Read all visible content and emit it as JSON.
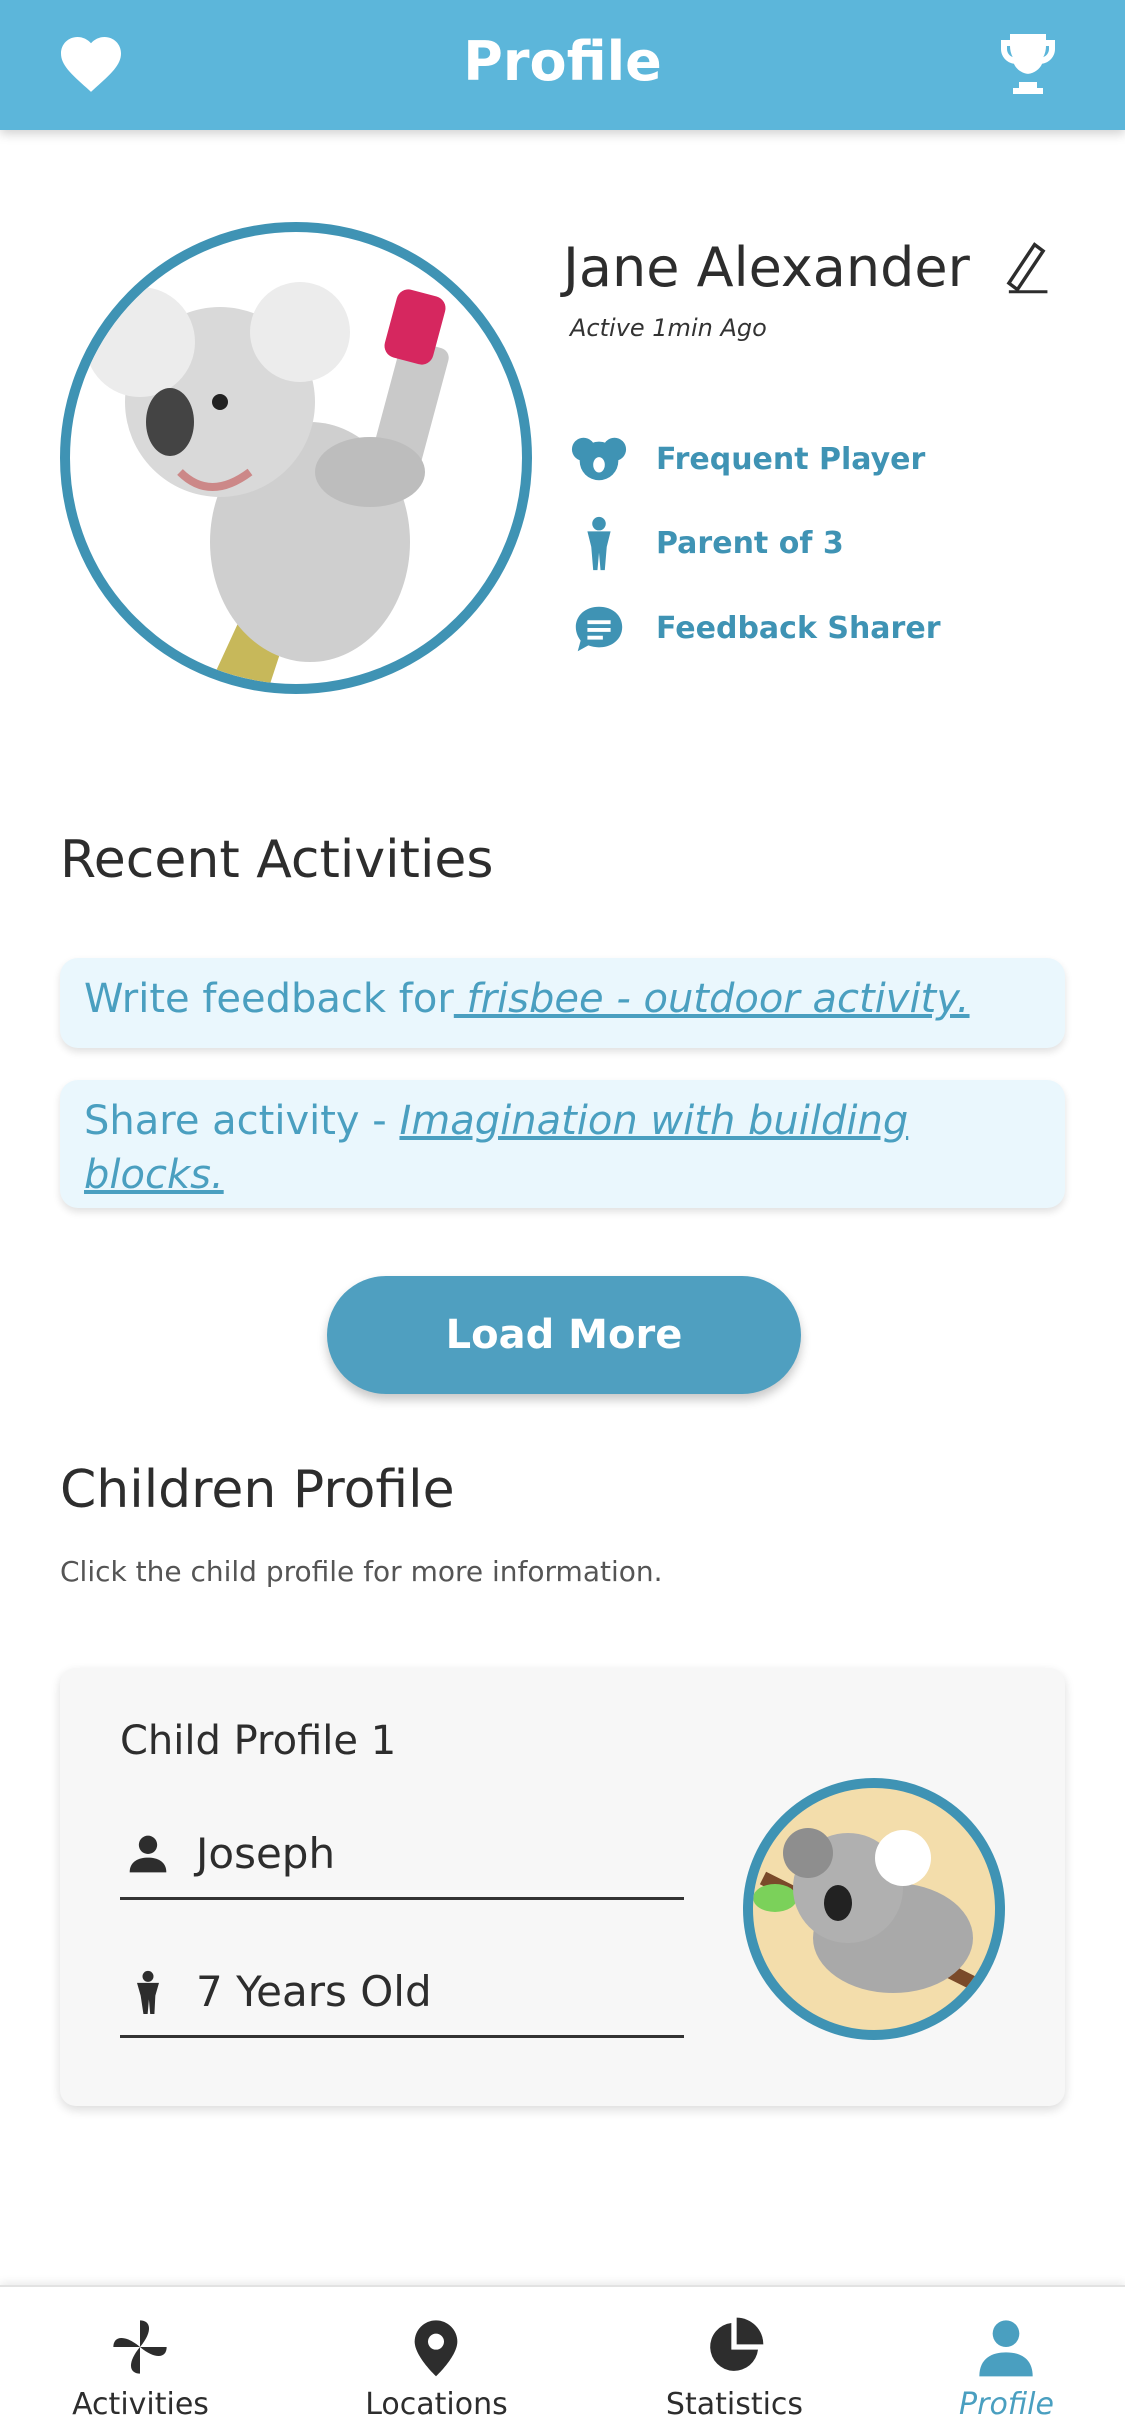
{
  "header": {
    "title": "Profile",
    "left_icon": "heart-icon",
    "right_icon": "trophy-icon"
  },
  "profile": {
    "name": "Jane Alexander",
    "status": "Active 1min Ago",
    "badges": [
      {
        "icon": "koala-icon",
        "label": "Frequent Player"
      },
      {
        "icon": "child-icon",
        "label": "Parent of 3"
      },
      {
        "icon": "chat-icon",
        "label": "Feedback Sharer"
      }
    ]
  },
  "recent": {
    "title": "Recent Activities",
    "items": [
      {
        "prefix": "Write feedback for",
        "link": " frisbee - outdoor activity."
      },
      {
        "prefix": "Share activity - ",
        "link": "Imagination with building blocks."
      }
    ],
    "load_more": "Load More"
  },
  "children": {
    "title": "Children Profile",
    "subtitle": "Click the child profile for more information.",
    "cards": [
      {
        "title": "Child Profile 1",
        "name": "Joseph",
        "age": "7 Years Old"
      }
    ]
  },
  "nav": {
    "items": [
      {
        "label": "Activities",
        "icon": "pinwheel-icon"
      },
      {
        "label": "Locations",
        "icon": "location-pin-icon"
      },
      {
        "label": "Statistics",
        "icon": "pie-chart-icon"
      },
      {
        "label": "Profile",
        "icon": "person-icon",
        "active": true
      }
    ]
  },
  "colors": {
    "header": "#5cb6da",
    "accent": "#3f93b4",
    "activity_bg": "#eaf7fd"
  }
}
